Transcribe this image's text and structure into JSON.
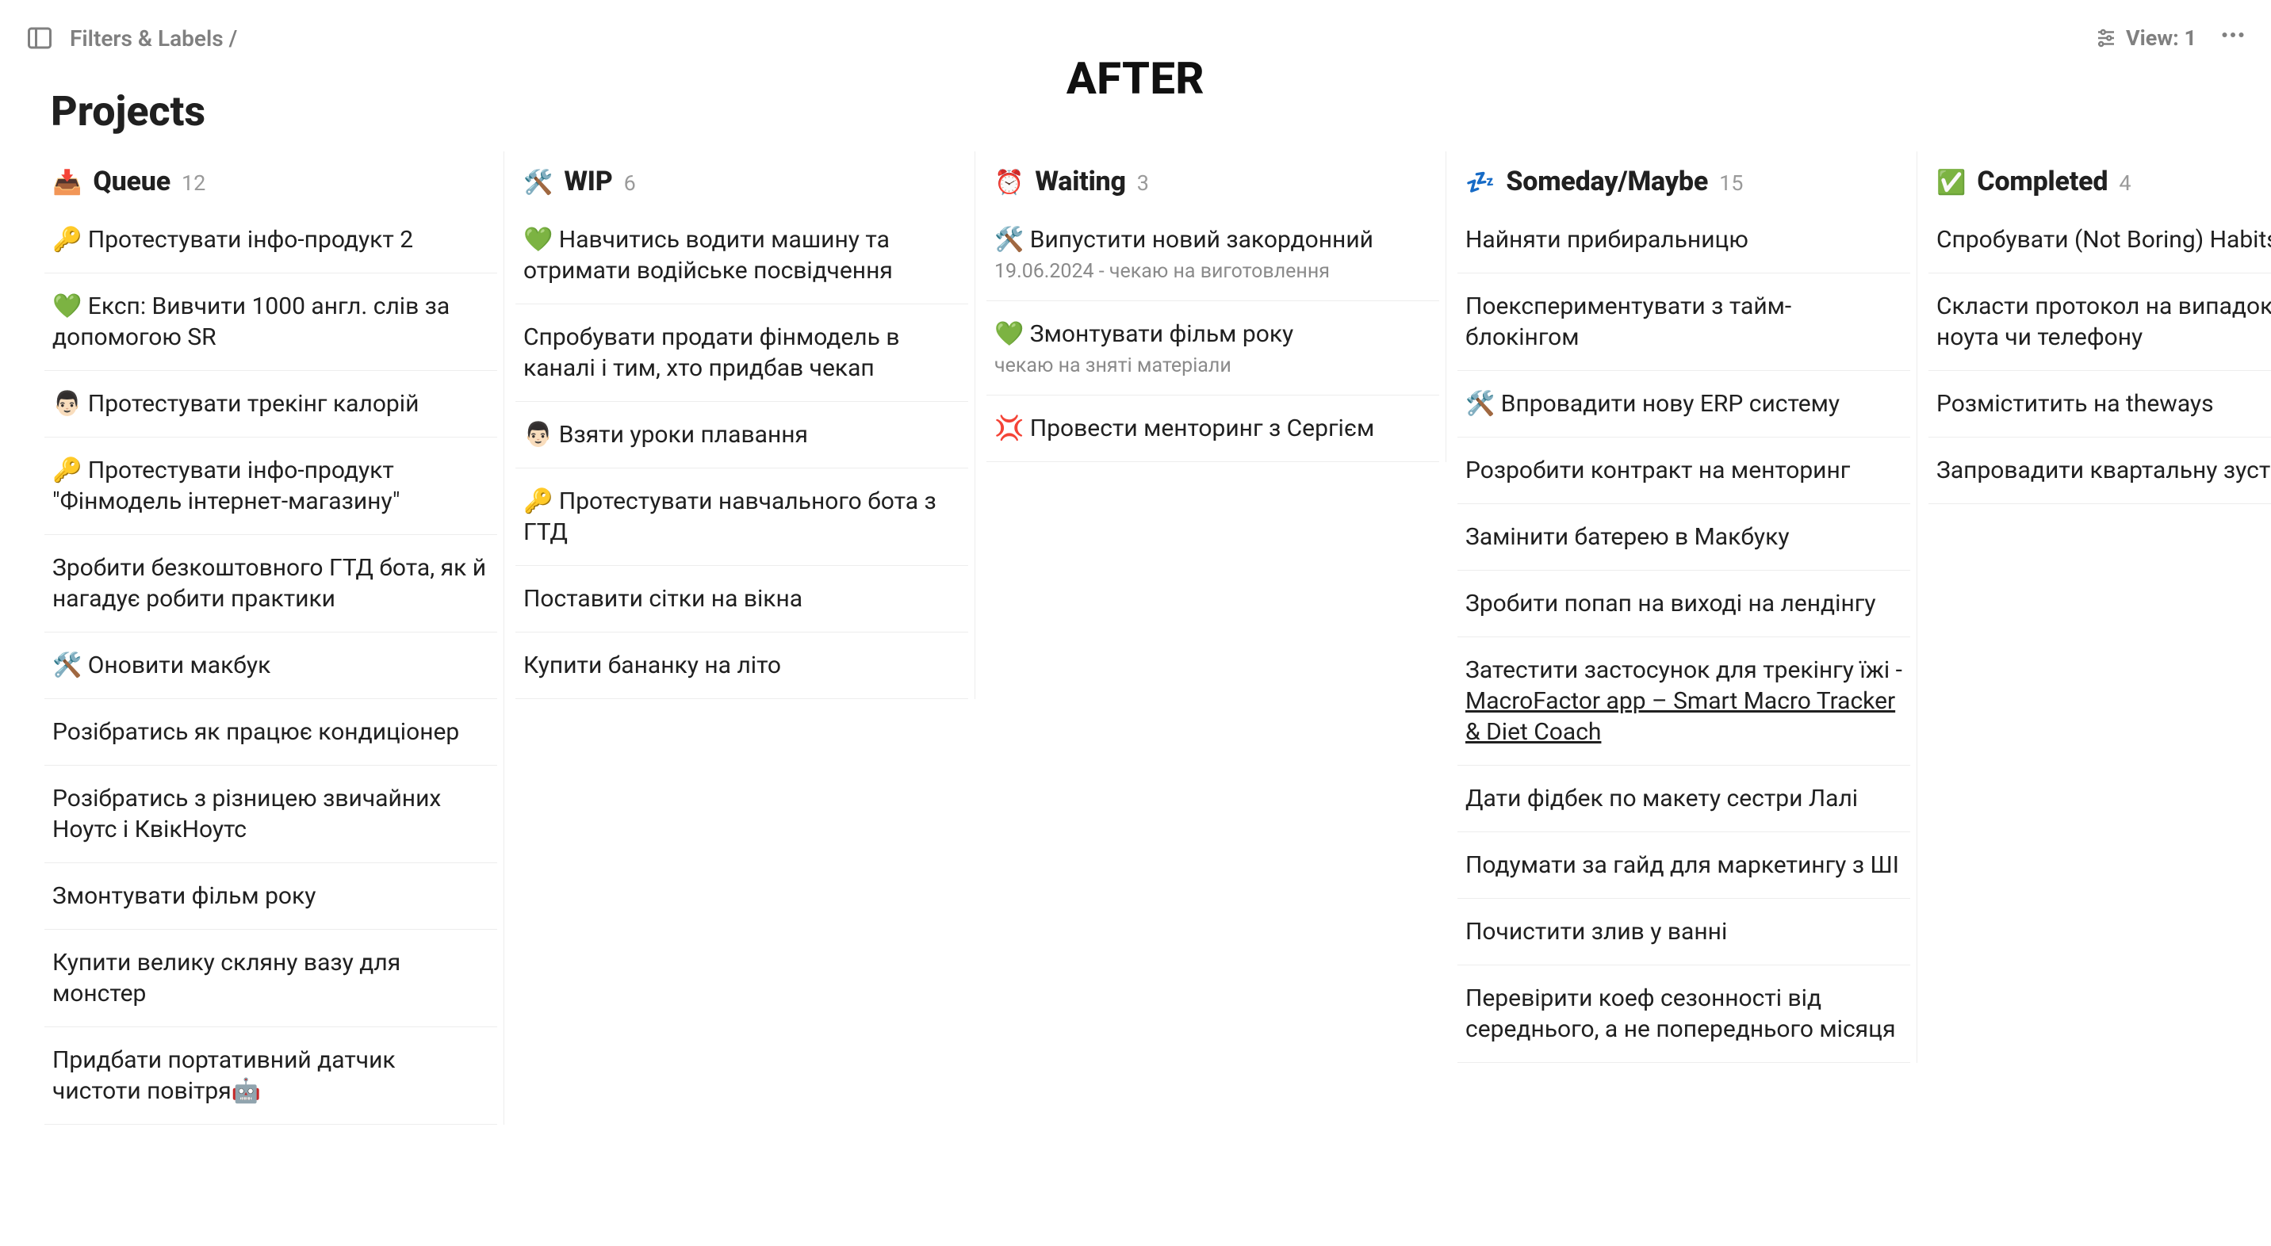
{
  "topbar": {
    "breadcrumb": "Filters & Labels /",
    "view_label": "View: 1"
  },
  "title_overlay": "AFTER",
  "page_heading": "Projects",
  "columns": [
    {
      "icon": "📥",
      "title": "Queue",
      "count": "12",
      "cards": [
        {
          "title": "🔑 Протестувати інфо-продукт 2"
        },
        {
          "title": "💚 Експ: Вивчити 1000 англ. слів за допомогою SR"
        },
        {
          "title": "👨🏻 Протестувати трекінг калорій"
        },
        {
          "title": "🔑 Протестувати інфо-продукт \"Фінмодель інтернет-магазину\""
        },
        {
          "title": "Зробити безкоштовного ГТД бота, як й нагадує робити практики"
        },
        {
          "title": "🛠️ Оновити макбук"
        },
        {
          "title": "Розібратись як працює кондиціонер"
        },
        {
          "title": "Розібратись з різницею звичайних Ноутс і КвікНоутс"
        },
        {
          "title": "Змонтувати фільм року"
        },
        {
          "title": "Купити велику скляну вазу для монстер"
        },
        {
          "title": "Придбати портативний датчик чистоти повітря🤖"
        }
      ]
    },
    {
      "icon": "🛠️",
      "title": "WIP",
      "count": "6",
      "cards": [
        {
          "title": "💚 Навчитись водити машину та отримати водійське посвідчення"
        },
        {
          "title": "Спробувати продати фінмодель в каналі і тим, хто придбав чекап"
        },
        {
          "title": "👨🏻 Взяти уроки плавання"
        },
        {
          "title": "🔑 Протестувати навчального бота з ГТД"
        },
        {
          "title": "Поставити сітки на вікна"
        },
        {
          "title": "Купити бананку на літо"
        }
      ]
    },
    {
      "icon": "⏰",
      "title": "Waiting",
      "count": "3",
      "cards": [
        {
          "title": "🛠️ Випустити новий закордонний",
          "sub": "19.06.2024 - чекаю на виготовлення"
        },
        {
          "title": "💚 Змонтувати фільм року",
          "sub": "чекаю на зняті матеріали"
        },
        {
          "title": "💢 Провести менторинг з Сергієм"
        }
      ]
    },
    {
      "icon": "💤",
      "title": "Someday/Maybe",
      "count": "15",
      "cards": [
        {
          "title": "Найняти прибиральницю"
        },
        {
          "title": "Поекспериментувати з тайм-блокінгом"
        },
        {
          "title": "🛠️ Впровадити нову ERP систему"
        },
        {
          "title": "Розробити контракт на менторинг"
        },
        {
          "title": "Замінити батерею в Макбуку"
        },
        {
          "title": "Зробити попап на виході на лендінгу"
        },
        {
          "title_prefix": "Затестити застосунок для трекінгу їжі - ",
          "title_link": "MacroFactor app – Smart Macro Tracker & Diet Coach"
        },
        {
          "title": "Дати фідбек по макету сестри Лалі"
        },
        {
          "title": "Подумати за гайд для маркетингу з ШІ"
        },
        {
          "title": "Почистити злив у ванні"
        },
        {
          "title": "Перевірити коеф сезонності від середнього, а не попереднього місяця"
        }
      ]
    },
    {
      "icon": "✅",
      "title": "Completed",
      "count": "4",
      "cards": [
        {
          "title": "Спробувати (Not Boring) Habits app"
        },
        {
          "title": "Скласти протокол на випадок втрати ноута чи телефону"
        },
        {
          "title": "Розміститить на theways"
        },
        {
          "title": "Запровадити квартальну зустріч з CEO"
        }
      ]
    }
  ]
}
